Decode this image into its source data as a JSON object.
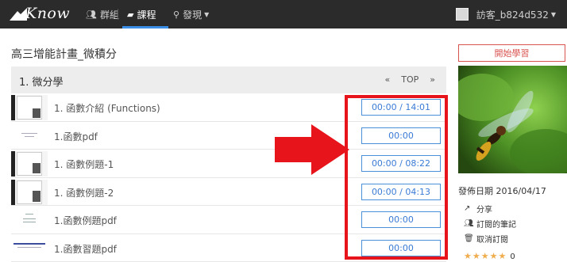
{
  "navbar": {
    "logo_text": "Know",
    "items": [
      {
        "label": "群組",
        "icon": "users-icon"
      },
      {
        "label": "課程",
        "icon": "book-icon"
      },
      {
        "label": "發現",
        "icon": "search-icon"
      }
    ],
    "user_name": "訪客_b824d532"
  },
  "page": {
    "title": "高三增能計畫_微積分"
  },
  "section": {
    "title": "1. 微分學",
    "prev": "«",
    "top": "TOP",
    "next": "»"
  },
  "rows": [
    {
      "title": "1. 函數介紹 (Functions)",
      "time": "00:00 / 14:01",
      "thumb": "video"
    },
    {
      "title": "1.函數pdf",
      "time": "00:00",
      "thumb": "pdf"
    },
    {
      "title": "1. 函數例題-1",
      "time": "00:00 / 08:22",
      "thumb": "video"
    },
    {
      "title": "1. 函數例題-2",
      "time": "00:00 / 04:13",
      "thumb": "video"
    },
    {
      "title": "1.函數例題pdf",
      "time": "00:00",
      "thumb": "pdf"
    },
    {
      "title": "1.函數習題pdf",
      "time": "00:00",
      "thumb": "pdf-blue"
    }
  ],
  "sidebar": {
    "start_label": "開始學習",
    "publish_date": "發佈日期 2016/04/17",
    "links": [
      {
        "label": "分享",
        "icon": "share-icon"
      },
      {
        "label": "訂閱的筆記",
        "icon": "users-icon"
      },
      {
        "label": "取消訂閱",
        "icon": "trash-icon"
      }
    ],
    "rating": {
      "stars": 5,
      "count": "0"
    }
  },
  "colors": {
    "navbar_bg": "#2b2b2b",
    "accent_blue": "#3a7bd5",
    "highlight_red": "#e8141b",
    "start_button": "#d9534f",
    "star": "#f0ad4e"
  }
}
